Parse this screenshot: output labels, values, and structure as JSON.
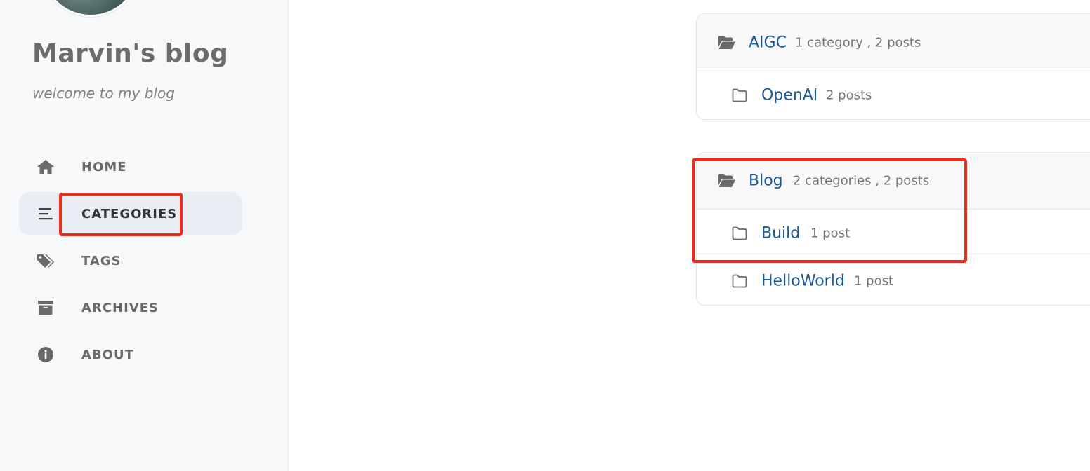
{
  "site": {
    "title": "Marvin's blog",
    "subtitle": "welcome to my blog"
  },
  "nav": {
    "items": [
      {
        "label": "HOME",
        "icon": "home-icon",
        "active": false
      },
      {
        "label": "CATEGORIES",
        "icon": "stream-icon",
        "active": true
      },
      {
        "label": "TAGS",
        "icon": "tags-icon",
        "active": false
      },
      {
        "label": "ARCHIVES",
        "icon": "archive-icon",
        "active": false
      },
      {
        "label": "ABOUT",
        "icon": "info-circle-icon",
        "active": false
      }
    ]
  },
  "categories": [
    {
      "name": "AIGC",
      "meta": "1 category , 2 posts",
      "children": [
        {
          "name": "OpenAI",
          "meta": "2 posts"
        }
      ]
    },
    {
      "name": "Blog",
      "meta": "2 categories , 2 posts",
      "children": [
        {
          "name": "Build",
          "meta": "1 post"
        },
        {
          "name": "HelloWorld",
          "meta": "1 post"
        }
      ]
    }
  ],
  "colors": {
    "link": "#1b5a96",
    "meta": "#757575",
    "highlight": "#ea2b20",
    "sidebar_bg": "#f6f8fa",
    "active_nav_bg": "#e9eef5"
  }
}
